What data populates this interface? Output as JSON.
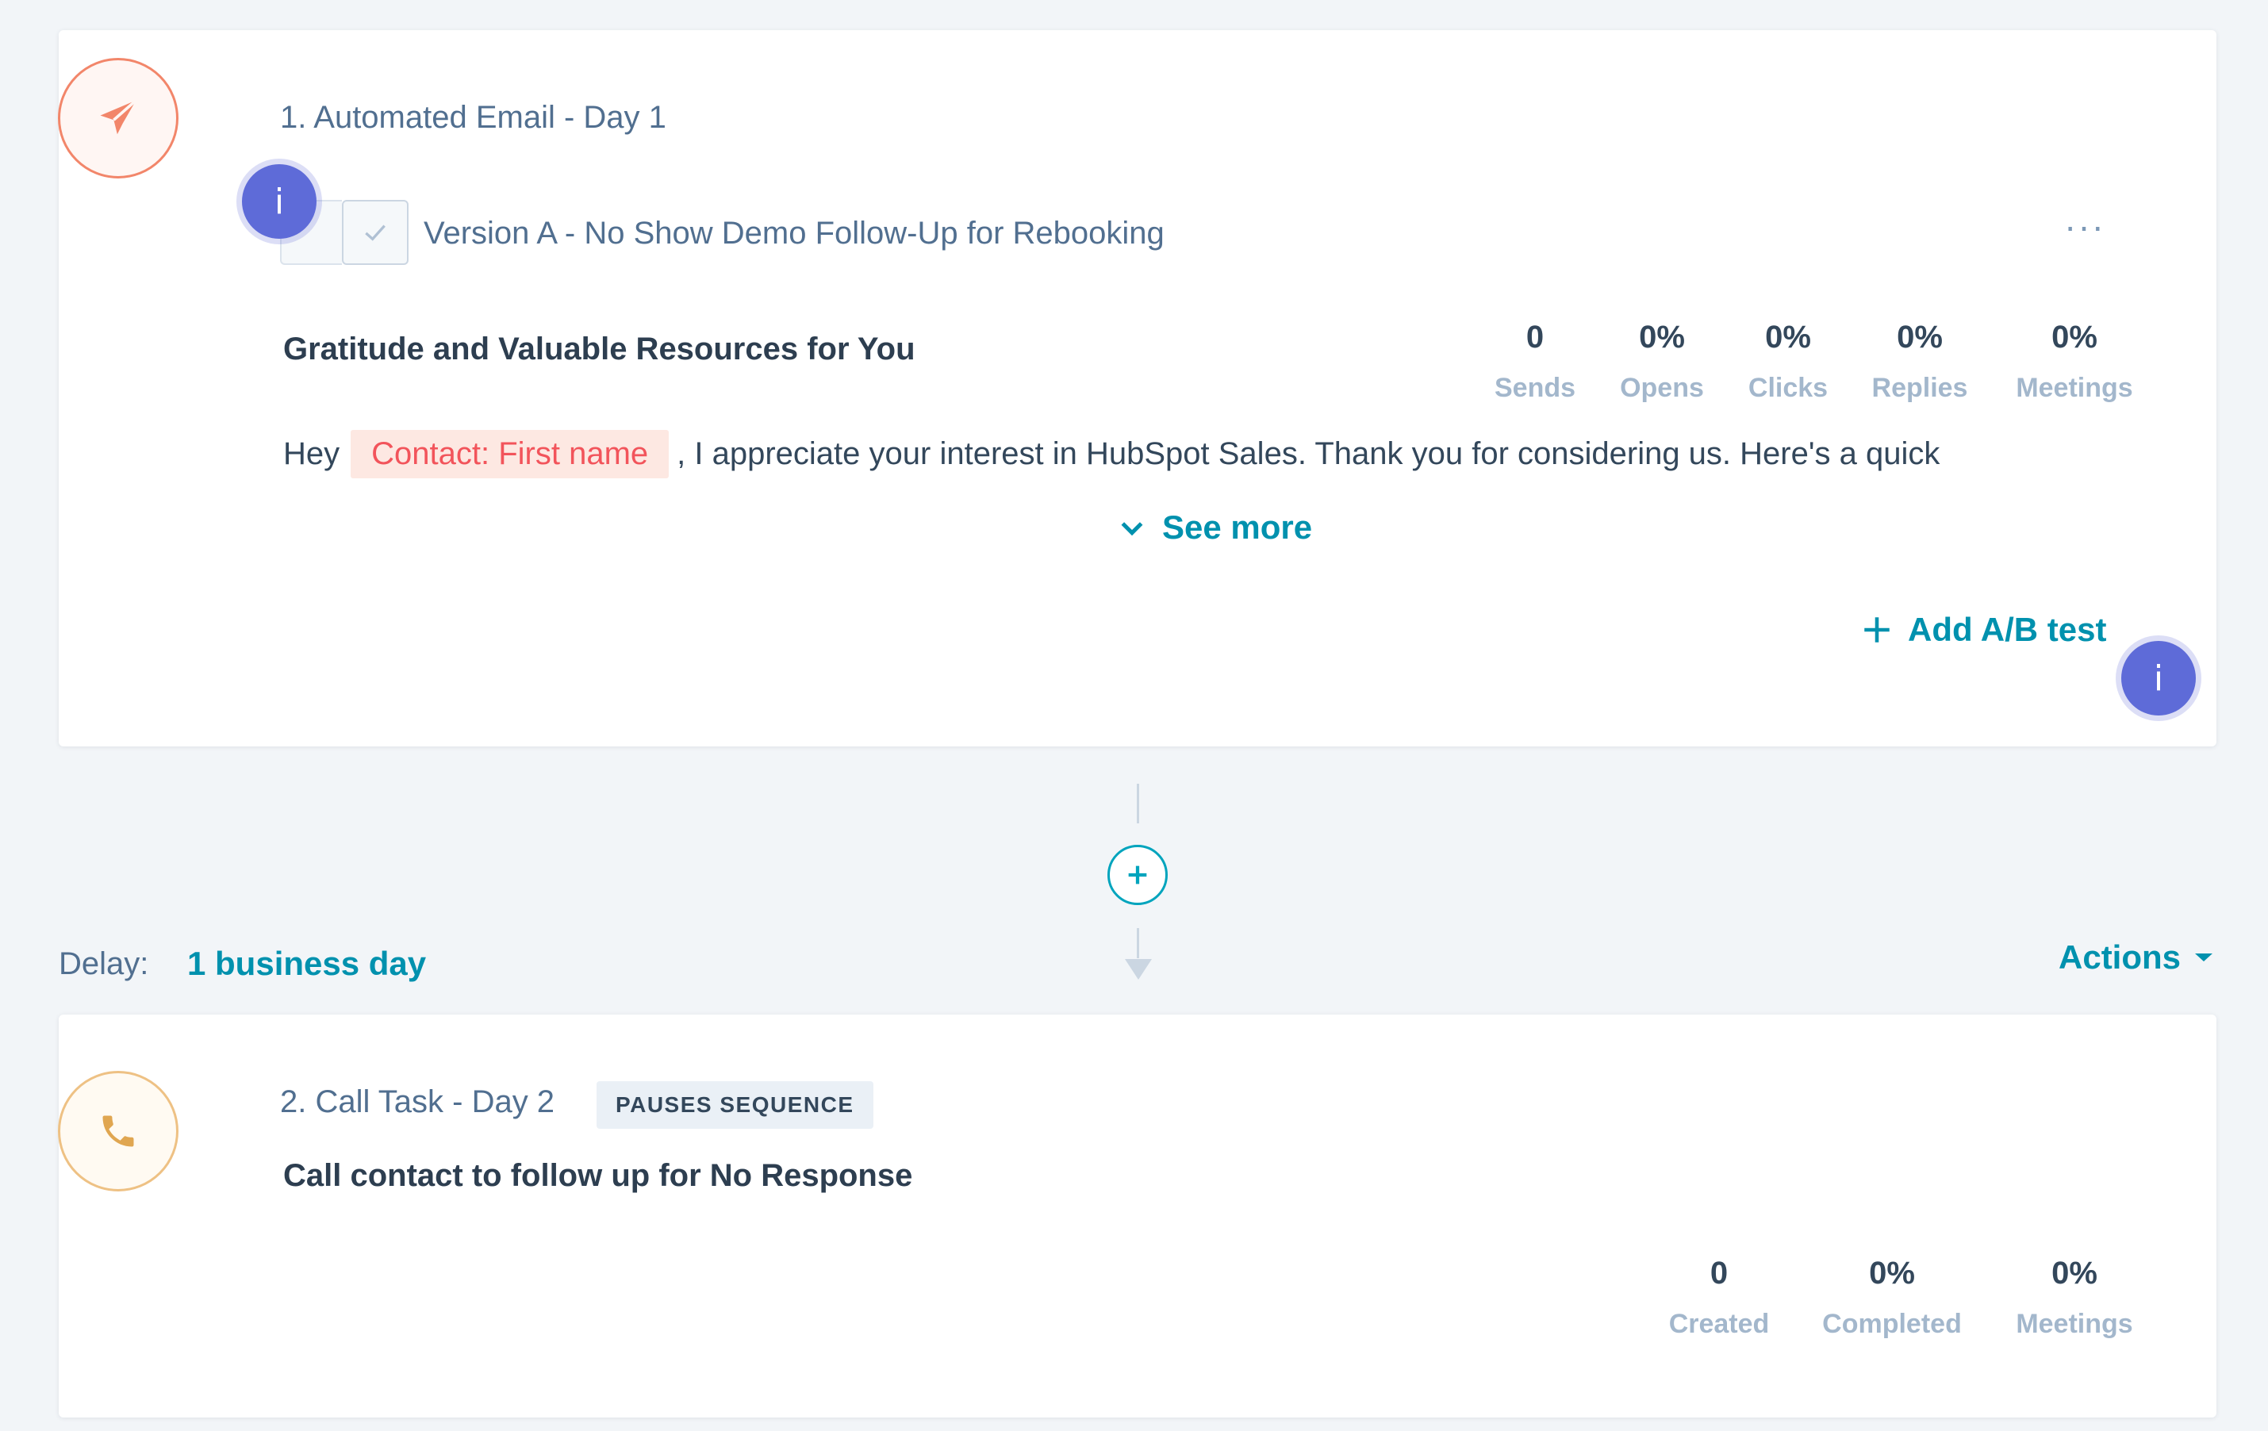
{
  "steps": [
    {
      "title": "1. Automated Email - Day 1",
      "version_label": "Version A - No Show Demo Follow-Up for Rebooking",
      "subject": "Gratitude and Valuable Resources for You",
      "body_prefix": "Hey",
      "body_token": "Contact: First name",
      "body_suffix": ", I appreciate your interest in HubSpot Sales. Thank you for considering us. Here's a quick",
      "see_more": "See more",
      "add_ab_test": "Add A/B test",
      "more_menu": "···",
      "info_label": "i",
      "stats": [
        {
          "value": "0",
          "label": "Sends"
        },
        {
          "value": "0%",
          "label": "Opens"
        },
        {
          "value": "0%",
          "label": "Clicks"
        },
        {
          "value": "0%",
          "label": "Replies"
        },
        {
          "value": "0%",
          "label": "Meetings"
        }
      ]
    },
    {
      "title": "2. Call Task - Day 2",
      "badge": "PAUSES SEQUENCE",
      "task_title": "Call contact to follow up for No Response",
      "stats": [
        {
          "value": "0",
          "label": "Created"
        },
        {
          "value": "0%",
          "label": "Completed"
        },
        {
          "value": "0%",
          "label": "Meetings"
        }
      ]
    }
  ],
  "delay": {
    "label": "Delay:",
    "value": "1 business day"
  },
  "actions_label": "Actions",
  "icons": {
    "email": "paper-plane-icon",
    "call": "phone-icon",
    "info": "info-icon",
    "check": "check-icon",
    "chevron": "chevron-down-icon",
    "plus": "plus-icon",
    "caret": "caret-down-icon",
    "arrow": "arrow-down-icon"
  },
  "colors": {
    "accent_teal": "#0091ae",
    "email_icon": "#f2866a",
    "call_icon": "#eec184",
    "info_badge": "#5e6bd8",
    "token_text": "#f2545b",
    "token_bg": "#fde8e2"
  }
}
